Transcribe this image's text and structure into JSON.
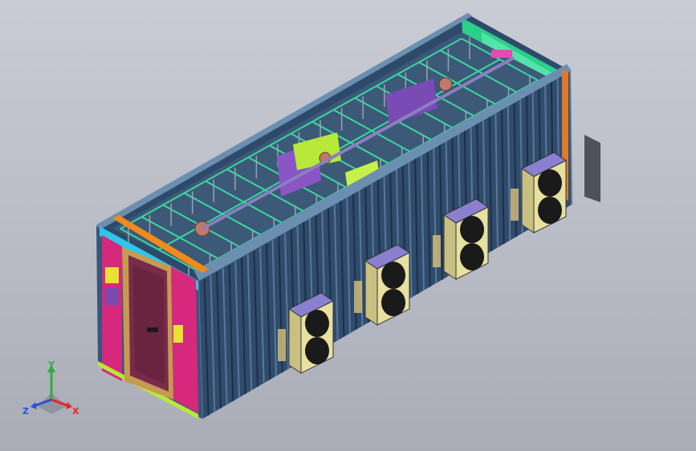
{
  "viewport": {
    "background_top": "#c9ccd4",
    "background_bottom": "#a9acb6"
  },
  "model": {
    "subject": "container",
    "colors": {
      "wall": "#2f4b6e",
      "wall_rib": "#1c2f48",
      "frame": "#3aa86a",
      "floor_green": "#2fd08a",
      "rack_green": "#39d7a0",
      "magenta": "#d6287c",
      "cyan": "#2ec7e8",
      "orange": "#f08a1c",
      "door": "#7a2a4a",
      "purple": "#7b4bb0",
      "yellow": "#e8e233",
      "lime": "#b7e83a",
      "ac_body": "#e7e0a0",
      "ac_top": "#8b7fd0",
      "fan": "#1a1a1a"
    },
    "ac_units": 4
  },
  "triad": {
    "x_label": "X",
    "y_label": "Y",
    "z_label": "Z",
    "x_color": "#e5262a",
    "y_color": "#2fae3a",
    "z_color": "#2a4fd6"
  }
}
